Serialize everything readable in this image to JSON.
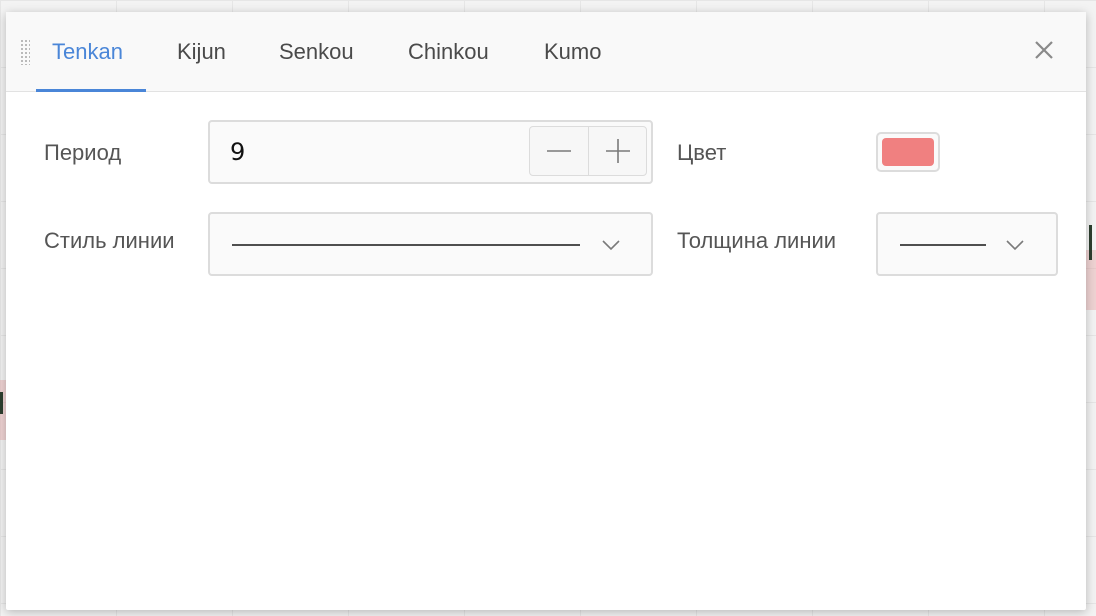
{
  "dialog": {
    "tabs": [
      {
        "label": "Tenkan",
        "active": true
      },
      {
        "label": "Kijun",
        "active": false
      },
      {
        "label": "Senkou",
        "active": false
      },
      {
        "label": "Chinkou",
        "active": false
      },
      {
        "label": "Kumo",
        "active": false
      }
    ],
    "close_icon": "close-icon",
    "drag_icon": "drag-handle-icon"
  },
  "form": {
    "period": {
      "label": "Период",
      "value": "9",
      "decrement_icon": "minus-icon",
      "increment_icon": "plus-icon"
    },
    "color": {
      "label": "Цвет",
      "value": "#f08080"
    },
    "line_style": {
      "label": "Стиль линии",
      "value": "solid",
      "icon": "chevron-down-icon"
    },
    "line_width": {
      "label": "Толщина линии",
      "value": "thin",
      "icon": "chevron-down-icon"
    }
  },
  "colors": {
    "accent": "#4a86d8",
    "text": "#555555",
    "border": "#dcdcdc"
  }
}
